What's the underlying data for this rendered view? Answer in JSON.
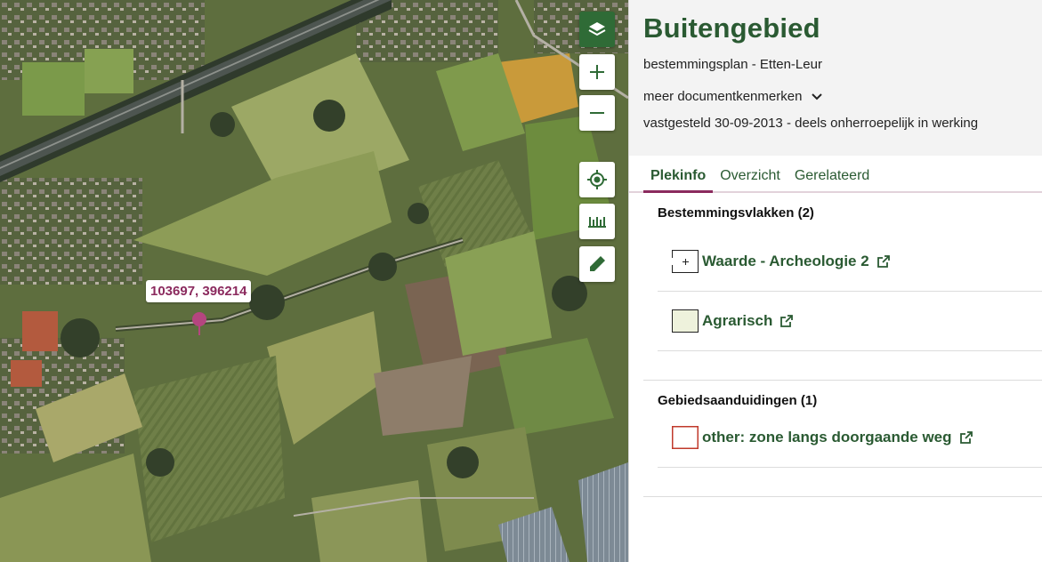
{
  "map": {
    "coordinate_label": "103697, 396214",
    "controls": {
      "layers": "layers-icon",
      "zoom_in": "plus-icon",
      "zoom_out": "minus-icon",
      "locate": "crosshair-icon",
      "measure": "ruler-icon",
      "draw": "pencil-icon"
    },
    "colors": {
      "accent": "#2f6b36",
      "pin": "#b5457f"
    }
  },
  "panel": {
    "title": "Buitengebied",
    "subtitle": "bestemmingsplan - Etten-Leur",
    "more_label": "meer documentkenmerken",
    "status": "vastgesteld 30-09-2013 - deels onherroepelijk in werking",
    "tabs": [
      {
        "label": "Plekinfo",
        "active": true
      },
      {
        "label": "Overzicht",
        "active": false
      },
      {
        "label": "Gerelateerd",
        "active": false
      }
    ],
    "sections": [
      {
        "title": "Bestemmingsvlakken (2)",
        "items": [
          {
            "label": "Waarde - Archeologie 2",
            "swatch": "archeologie"
          },
          {
            "label": "Agrarisch",
            "swatch": "agrarisch"
          }
        ]
      },
      {
        "title": "Gebiedsaanduidingen (1)",
        "items": [
          {
            "label": "other: zone langs doorgaande weg",
            "swatch": "zone"
          }
        ]
      }
    ],
    "colors": {
      "title": "#2a5a32",
      "tab_accent": "#8b2a5e",
      "header_bg": "#f3f3f3"
    }
  }
}
